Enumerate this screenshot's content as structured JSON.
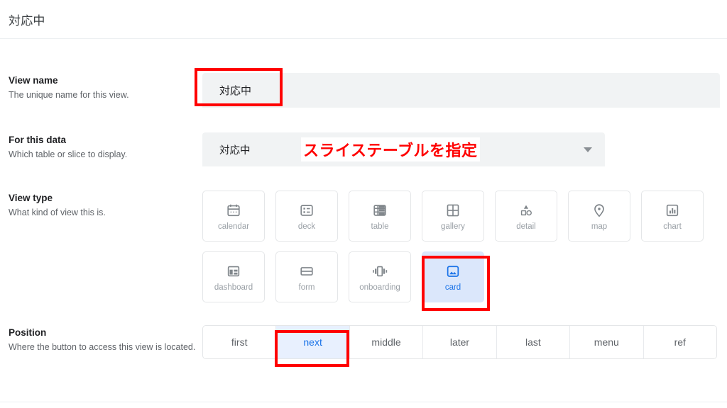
{
  "header": {
    "title": "対応中"
  },
  "fields": {
    "view_name": {
      "label": "View name",
      "description": "The unique name for this view.",
      "value": "対応中"
    },
    "for_this_data": {
      "label": "For this data",
      "description": "Which table or slice to display.",
      "value": "対応中",
      "caret_icon": "chevron-down-icon"
    },
    "view_type": {
      "label": "View type",
      "description": "What kind of view this is.",
      "selected": "card",
      "options": [
        {
          "label": "calendar",
          "icon": "calendar-icon",
          "selected": false
        },
        {
          "label": "deck",
          "icon": "deck-icon",
          "selected": false
        },
        {
          "label": "table",
          "icon": "table-icon",
          "selected": false
        },
        {
          "label": "gallery",
          "icon": "gallery-icon",
          "selected": false
        },
        {
          "label": "detail",
          "icon": "detail-icon",
          "selected": false
        },
        {
          "label": "map",
          "icon": "map-pin-icon",
          "selected": false
        },
        {
          "label": "chart",
          "icon": "chart-icon",
          "selected": false
        },
        {
          "label": "dashboard",
          "icon": "dashboard-icon",
          "selected": false
        },
        {
          "label": "form",
          "icon": "form-icon",
          "selected": false
        },
        {
          "label": "onboarding",
          "icon": "onboarding-icon",
          "selected": false
        },
        {
          "label": "card",
          "icon": "image-card-icon",
          "selected": true
        }
      ]
    },
    "position": {
      "label": "Position",
      "description": "Where the button to access this view is located.",
      "selected": "next",
      "options": [
        {
          "label": "first",
          "selected": false
        },
        {
          "label": "next",
          "selected": true
        },
        {
          "label": "middle",
          "selected": false
        },
        {
          "label": "later",
          "selected": false
        },
        {
          "label": "last",
          "selected": false
        },
        {
          "label": "menu",
          "selected": false
        },
        {
          "label": "ref",
          "selected": false
        }
      ]
    }
  },
  "annotations": {
    "color": "#ff0000",
    "note_text": "スライステーブルを指定",
    "boxes": [
      {
        "name": "view-name-field"
      },
      {
        "name": "view-type-card-tile"
      },
      {
        "name": "position-next-segment"
      }
    ]
  },
  "colors": {
    "accent": "#1a73e8",
    "selected_tile_bg": "#dbe7fb",
    "selected_seg_bg": "#e8f0fe",
    "field_bg": "#f1f3f4",
    "annotation": "#ff0000"
  }
}
